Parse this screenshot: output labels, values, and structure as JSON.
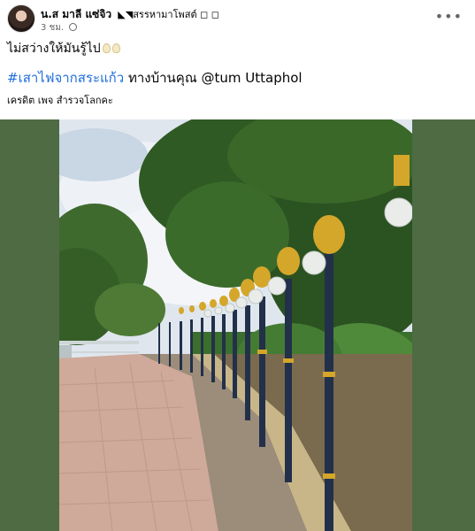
{
  "post": {
    "author": "น.ส มาลี แซ่จิว",
    "group": "◣◥สรรหามาโพสต์ ◻ ◻",
    "time": "3 ชม.",
    "more_icon": "more-horizontal-icon",
    "privacy_icon": "globe-icon",
    "line1": "ไม่สว่างให้มันรู้ไป",
    "hashtag": "#เสาไฟจากสระแก้ว",
    "line2_rest": " ทางบ้านคุณ @tum Uttaphol",
    "credit": "เครดิต เพจ สำรวจโลกคะ"
  },
  "photo": {
    "description_icon": "street-lamps-photo",
    "lamp_count": 12
  }
}
